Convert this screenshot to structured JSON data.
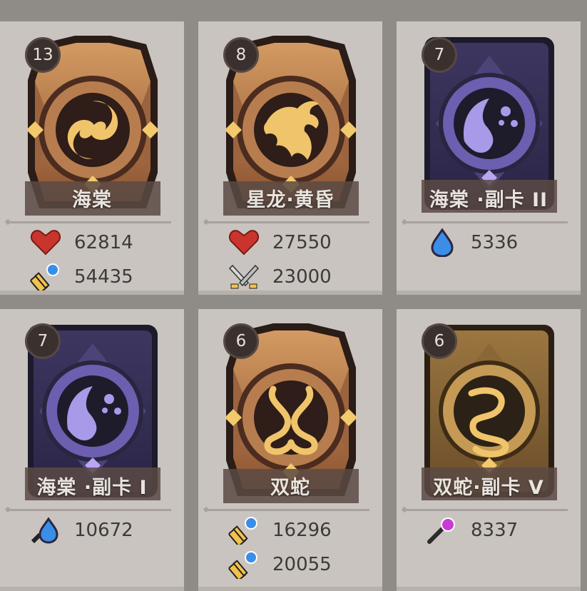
{
  "cards": [
    {
      "level": "13",
      "name": "海棠",
      "theme": "orange",
      "emblem": "koi-swirl-icon",
      "stats": [
        {
          "icon": "heart-icon",
          "value": "62814"
        },
        {
          "icon": "hammer-orb-icon",
          "value": "54435"
        }
      ]
    },
    {
      "level": "8",
      "name": "星龙·黄昏",
      "theme": "orange",
      "emblem": "dragon-icon",
      "stats": [
        {
          "icon": "heart-icon",
          "value": "27550"
        },
        {
          "icon": "crossed-swords-icon",
          "value": "23000"
        }
      ]
    },
    {
      "level": "7",
      "name": "海棠 ·副卡 II",
      "theme": "purple",
      "emblem": "fish-moon-icon",
      "stats": [
        {
          "icon": "water-drop-icon",
          "value": "5336"
        }
      ]
    },
    {
      "level": "7",
      "name": "海棠 ·副卡 I",
      "theme": "purple",
      "emblem": "fish-moon-icon",
      "stats": [
        {
          "icon": "water-drop-icon",
          "value": "10672"
        }
      ]
    },
    {
      "level": "6",
      "name": "双蛇",
      "theme": "orange",
      "emblem": "twin-serpents-icon",
      "stats": [
        {
          "icon": "hammer-orb-icon",
          "value": "16296"
        },
        {
          "icon": "hammer-orb-icon",
          "value": "20055"
        }
      ]
    },
    {
      "level": "6",
      "name": "双蛇·副卡 V",
      "theme": "gold",
      "emblem": "serpent-icon",
      "stats": [
        {
          "icon": "magic-staff-icon",
          "value": "8337"
        }
      ]
    }
  ],
  "colors": {
    "orange_frame": "#c98a55",
    "purple_frame": "#6b5fa6",
    "gold_frame": "#b38a45",
    "heart": "#c9352d",
    "water": "#3a8ee8",
    "gold_emblem": "#f0c46a"
  }
}
